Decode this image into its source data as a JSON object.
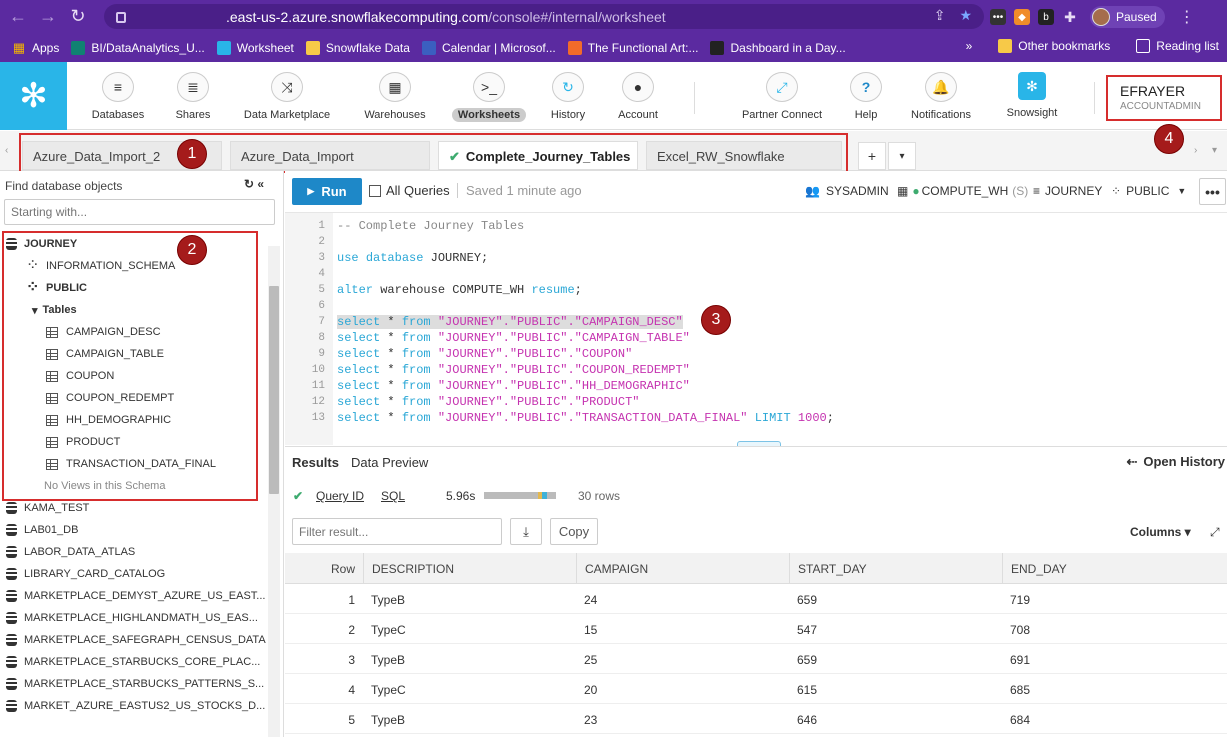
{
  "browser": {
    "url_host": ".east-us-2.azure.snowflakecomputing.com",
    "url_path": "/console#/internal/worksheet",
    "profile_label": "Paused"
  },
  "bookmarks": {
    "items": [
      {
        "label": "Apps",
        "color": "#f0f0f0"
      },
      {
        "label": "BI/DataAnalytics_U...",
        "color": "#108272"
      },
      {
        "label": "Worksheet",
        "color": "#29b5e8"
      },
      {
        "label": "Snowflake Data",
        "color": "#f7c948"
      },
      {
        "label": "Calendar | Microsof...",
        "color": "#3b5fc0"
      },
      {
        "label": "The Functional Art:...",
        "color": "#f26b2a"
      },
      {
        "label": "Dashboard in a Day...",
        "color": "#222222"
      }
    ],
    "more": "»",
    "other": "Other bookmarks",
    "reading": "Reading list"
  },
  "nav": {
    "items": [
      {
        "label": "Databases",
        "icon": "database-icon",
        "glyph": "≡"
      },
      {
        "label": "Shares",
        "icon": "shares-icon",
        "glyph": "≣"
      },
      {
        "label": "Data Marketplace",
        "icon": "marketplace-icon",
        "glyph": "⤨"
      },
      {
        "label": "Warehouses",
        "icon": "warehouse-icon",
        "glyph": "▦"
      },
      {
        "label": "Worksheets",
        "icon": "worksheet-icon",
        "glyph": ">_"
      },
      {
        "label": "History",
        "icon": "history-icon",
        "glyph": "↻"
      },
      {
        "label": "Account",
        "icon": "account-icon",
        "glyph": "●"
      },
      {
        "label": "Partner Connect",
        "icon": "partner-connect-icon",
        "glyph": "⤢"
      },
      {
        "label": "Help",
        "icon": "help-icon",
        "glyph": "?"
      },
      {
        "label": "Notifications",
        "icon": "bell-icon",
        "glyph": "🔔"
      },
      {
        "label": "Snowsight",
        "icon": "snowsight-icon",
        "glyph": "✻"
      }
    ],
    "active": "Worksheets",
    "user_name": "EFRAYER",
    "user_role": "ACCOUNTADMIN"
  },
  "tabs": {
    "items": [
      "Azure_Data_Import_2",
      "Azure_Data_Import",
      "Complete_Journey_Tables",
      "Excel_RW_Snowflake"
    ],
    "active": "Complete_Journey_Tables",
    "add_label": "+",
    "menu_label": "▾"
  },
  "badges": [
    "1",
    "2",
    "3",
    "4"
  ],
  "left_panel": {
    "title": "Find database objects",
    "search_placeholder": "Starting with...",
    "tree": [
      {
        "label": "JOURNEY",
        "type": "db",
        "level": 0,
        "bold": true
      },
      {
        "label": "INFORMATION_SCHEMA",
        "type": "schema",
        "level": 1
      },
      {
        "label": "PUBLIC",
        "type": "schema",
        "level": 1,
        "bold": true
      },
      {
        "label": "Tables",
        "type": "folder",
        "level": 1,
        "bold": true
      },
      {
        "label": "CAMPAIGN_DESC",
        "type": "table",
        "level": 2
      },
      {
        "label": "CAMPAIGN_TABLE",
        "type": "table",
        "level": 2
      },
      {
        "label": "COUPON",
        "type": "table",
        "level": 2
      },
      {
        "label": "COUPON_REDEMPT",
        "type": "table",
        "level": 2
      },
      {
        "label": "HH_DEMOGRAPHIC",
        "type": "table",
        "level": 2
      },
      {
        "label": "PRODUCT",
        "type": "table",
        "level": 2
      },
      {
        "label": "TRANSACTION_DATA_FINAL",
        "type": "table",
        "level": 2
      },
      {
        "label": "No Views in this Schema",
        "type": "note",
        "level": 2
      },
      {
        "label": "KAMA_TEST",
        "type": "db",
        "level": 0
      },
      {
        "label": "LAB01_DB",
        "type": "db",
        "level": 0
      },
      {
        "label": "LABOR_DATA_ATLAS",
        "type": "db",
        "level": 0
      },
      {
        "label": "LIBRARY_CARD_CATALOG",
        "type": "db",
        "level": 0
      },
      {
        "label": "MARKETPLACE_DEMYST_AZURE_US_EAST...",
        "type": "db",
        "level": 0
      },
      {
        "label": "MARKETPLACE_HIGHLANDMATH_US_EAS...",
        "type": "db",
        "level": 0
      },
      {
        "label": "MARKETPLACE_SAFEGRAPH_CENSUS_DATA",
        "type": "db",
        "level": 0
      },
      {
        "label": "MARKETPLACE_STARBUCKS_CORE_PLAC...",
        "type": "db",
        "level": 0
      },
      {
        "label": "MARKETPLACE_STARBUCKS_PATTERNS_S...",
        "type": "db",
        "level": 0
      },
      {
        "label": "MARKET_AZURE_EASTUS2_US_STOCKS_D...",
        "type": "db",
        "level": 0
      }
    ]
  },
  "toolbar": {
    "run_label": "Run",
    "all_queries_label": "All Queries",
    "saved_label": "Saved 1 minute ago",
    "role": "SYSADMIN",
    "warehouse": "COMPUTE_WH",
    "warehouse_size": "(S)",
    "database": "JOURNEY",
    "schema": "PUBLIC",
    "more": "•••"
  },
  "editor": {
    "lines": [
      [
        {
          "t": "-- Complete Journey Tables",
          "c": "comment"
        }
      ],
      [],
      [
        {
          "t": "use ",
          "c": "kw"
        },
        {
          "t": "database ",
          "c": "kw"
        },
        {
          "t": "JOURNEY;",
          "c": "txt"
        }
      ],
      [],
      [
        {
          "t": "alter ",
          "c": "kw"
        },
        {
          "t": "warehouse COMPUTE_WH ",
          "c": "txt"
        },
        {
          "t": "resume",
          "c": "kw"
        },
        {
          "t": ";",
          "c": "txt"
        }
      ],
      [],
      [
        {
          "t": "select ",
          "c": "kw"
        },
        {
          "t": "* ",
          "c": "txt"
        },
        {
          "t": "from ",
          "c": "kw"
        },
        {
          "t": "\"JOURNEY\".\"PUBLIC\".\"CAMPAIGN_DESC\"",
          "c": "str"
        }
      ],
      [
        {
          "t": "select ",
          "c": "kw"
        },
        {
          "t": "* ",
          "c": "txt"
        },
        {
          "t": "from ",
          "c": "kw"
        },
        {
          "t": "\"JOURNEY\".\"PUBLIC\".\"CAMPAIGN_TABLE\"",
          "c": "str"
        }
      ],
      [
        {
          "t": "select ",
          "c": "kw"
        },
        {
          "t": "* ",
          "c": "txt"
        },
        {
          "t": "from ",
          "c": "kw"
        },
        {
          "t": "\"JOURNEY\".\"PUBLIC\".\"COUPON\"",
          "c": "str"
        }
      ],
      [
        {
          "t": "select ",
          "c": "kw"
        },
        {
          "t": "* ",
          "c": "txt"
        },
        {
          "t": "from ",
          "c": "kw"
        },
        {
          "t": "\"JOURNEY\".\"PUBLIC\".\"COUPON_REDEMPT\"",
          "c": "str"
        }
      ],
      [
        {
          "t": "select ",
          "c": "kw"
        },
        {
          "t": "* ",
          "c": "txt"
        },
        {
          "t": "from ",
          "c": "kw"
        },
        {
          "t": "\"JOURNEY\".\"PUBLIC\".\"HH_DEMOGRAPHIC\"",
          "c": "str"
        }
      ],
      [
        {
          "t": "select ",
          "c": "kw"
        },
        {
          "t": "* ",
          "c": "txt"
        },
        {
          "t": "from ",
          "c": "kw"
        },
        {
          "t": "\"JOURNEY\".\"PUBLIC\".\"PRODUCT\"",
          "c": "str"
        }
      ],
      [
        {
          "t": "select ",
          "c": "kw"
        },
        {
          "t": "* ",
          "c": "txt"
        },
        {
          "t": "from ",
          "c": "kw"
        },
        {
          "t": "\"JOURNEY\".\"PUBLIC\".\"TRANSACTION_DATA_FINAL\" ",
          "c": "str"
        },
        {
          "t": "LIMIT ",
          "c": "kw"
        },
        {
          "t": "1000",
          "c": "str"
        },
        {
          "t": ";",
          "c": "txt"
        }
      ]
    ],
    "highlighted_line": 7
  },
  "results": {
    "tabs": [
      "Results",
      "Data Preview"
    ],
    "active_tab": "Results",
    "open_history": "Open History",
    "query_id_label": "Query ID",
    "sql_label": "SQL",
    "duration": "5.96s",
    "row_count": "30 rows",
    "filter_placeholder": "Filter result...",
    "copy_label": "Copy",
    "columns_label": "Columns ▾",
    "headers": [
      "Row",
      "DESCRIPTION",
      "CAMPAIGN",
      "START_DAY",
      "END_DAY"
    ],
    "rows": [
      [
        "1",
        "TypeB",
        "24",
        "659",
        "719"
      ],
      [
        "2",
        "TypeC",
        "15",
        "547",
        "708"
      ],
      [
        "3",
        "TypeB",
        "25",
        "659",
        "691"
      ],
      [
        "4",
        "TypeC",
        "20",
        "615",
        "685"
      ],
      [
        "5",
        "TypeB",
        "23",
        "646",
        "684"
      ]
    ]
  }
}
